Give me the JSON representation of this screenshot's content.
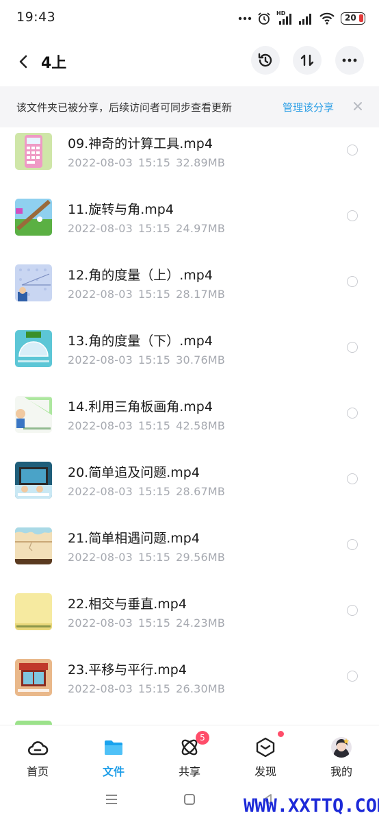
{
  "status": {
    "time": "19:43",
    "battery": "20",
    "hd_label": "HD"
  },
  "header": {
    "back_icon": "chevron-left-icon",
    "title": "4上",
    "history_icon": "history-clock-icon",
    "sort_icon": "sort-arrows-icon",
    "more_icon": "more-dots-icon"
  },
  "banner": {
    "text": "该文件夹已被分享，后续访问者可同步查看更新",
    "link": "管理该分享",
    "close_icon": "close-icon"
  },
  "files": [
    {
      "name": "09.神奇的计算工具.mp4",
      "date": "2022-08-03",
      "time": "15:15",
      "size": "32.89MB",
      "thumb": "calculator"
    },
    {
      "name": "11.旋转与角.mp4",
      "date": "2022-08-03",
      "time": "15:15",
      "size": "24.97MB",
      "thumb": "rotation"
    },
    {
      "name": "12.角的度量（上）.mp4",
      "date": "2022-08-03",
      "time": "15:15",
      "size": "28.17MB",
      "thumb": "angle-dots"
    },
    {
      "name": "13.角的度量（下）.mp4",
      "date": "2022-08-03",
      "time": "15:15",
      "size": "30.76MB",
      "thumb": "protractor"
    },
    {
      "name": "14.利用三角板画角.mp4",
      "date": "2022-08-03",
      "time": "15:15",
      "size": "42.58MB",
      "thumb": "triangle-ruler"
    },
    {
      "name": "20.简单追及问题.mp4",
      "date": "2022-08-03",
      "time": "15:15",
      "size": "28.67MB",
      "thumb": "chase"
    },
    {
      "name": "21.简单相遇问题.mp4",
      "date": "2022-08-03",
      "time": "15:15",
      "size": "29.56MB",
      "thumb": "meet"
    },
    {
      "name": "22.相交与垂直.mp4",
      "date": "2022-08-03",
      "time": "15:15",
      "size": "24.23MB",
      "thumb": "perpendicular"
    },
    {
      "name": "23.平移与平行.mp4",
      "date": "2022-08-03",
      "time": "15:15",
      "size": "26.30MB",
      "thumb": "window"
    }
  ],
  "nav": {
    "items": [
      {
        "label": "首页",
        "icon": "home-cloud-icon"
      },
      {
        "label": "文件",
        "icon": "folder-icon",
        "active": true
      },
      {
        "label": "共享",
        "icon": "share-atom-icon",
        "badge": "5"
      },
      {
        "label": "发现",
        "icon": "discover-cube-icon",
        "dot": true
      },
      {
        "label": "我的",
        "icon": "avatar-icon"
      }
    ]
  },
  "system_nav": {
    "menu_icon": "menu-lines-icon",
    "home_icon": "square-home-icon",
    "back_icon": "back-triangle-icon"
  },
  "watermark": "WWW.XXTTQ.COM",
  "colors": {
    "accent": "#1e9ee8",
    "link": "#2fa0e6",
    "badge": "#ff4d6a",
    "meta_text": "#a6a9b0",
    "banner_bg": "#f5f5f7",
    "watermark": "#1d2ad8"
  }
}
